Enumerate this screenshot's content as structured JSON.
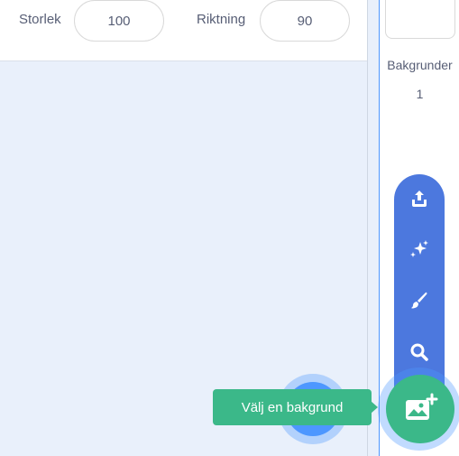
{
  "sprite_info": {
    "size_label": "Storlek",
    "size_value": "100",
    "direction_label": "Riktning",
    "direction_value": "90"
  },
  "stage": {
    "backdrops_label": "Bakgrunder",
    "backdrops_count": "1"
  },
  "backdrop_menu": {
    "items": [
      "upload-icon",
      "surprise-icon",
      "paint-icon",
      "search-icon"
    ],
    "main_icon": "backdrop-add-icon",
    "tooltip": "Välj en bakgrund"
  },
  "colors": {
    "menu_blue": "#4c78de",
    "green": "#3bb889",
    "sprite_blue": "#4d97ff",
    "pane_bg": "#e9f0fb"
  }
}
